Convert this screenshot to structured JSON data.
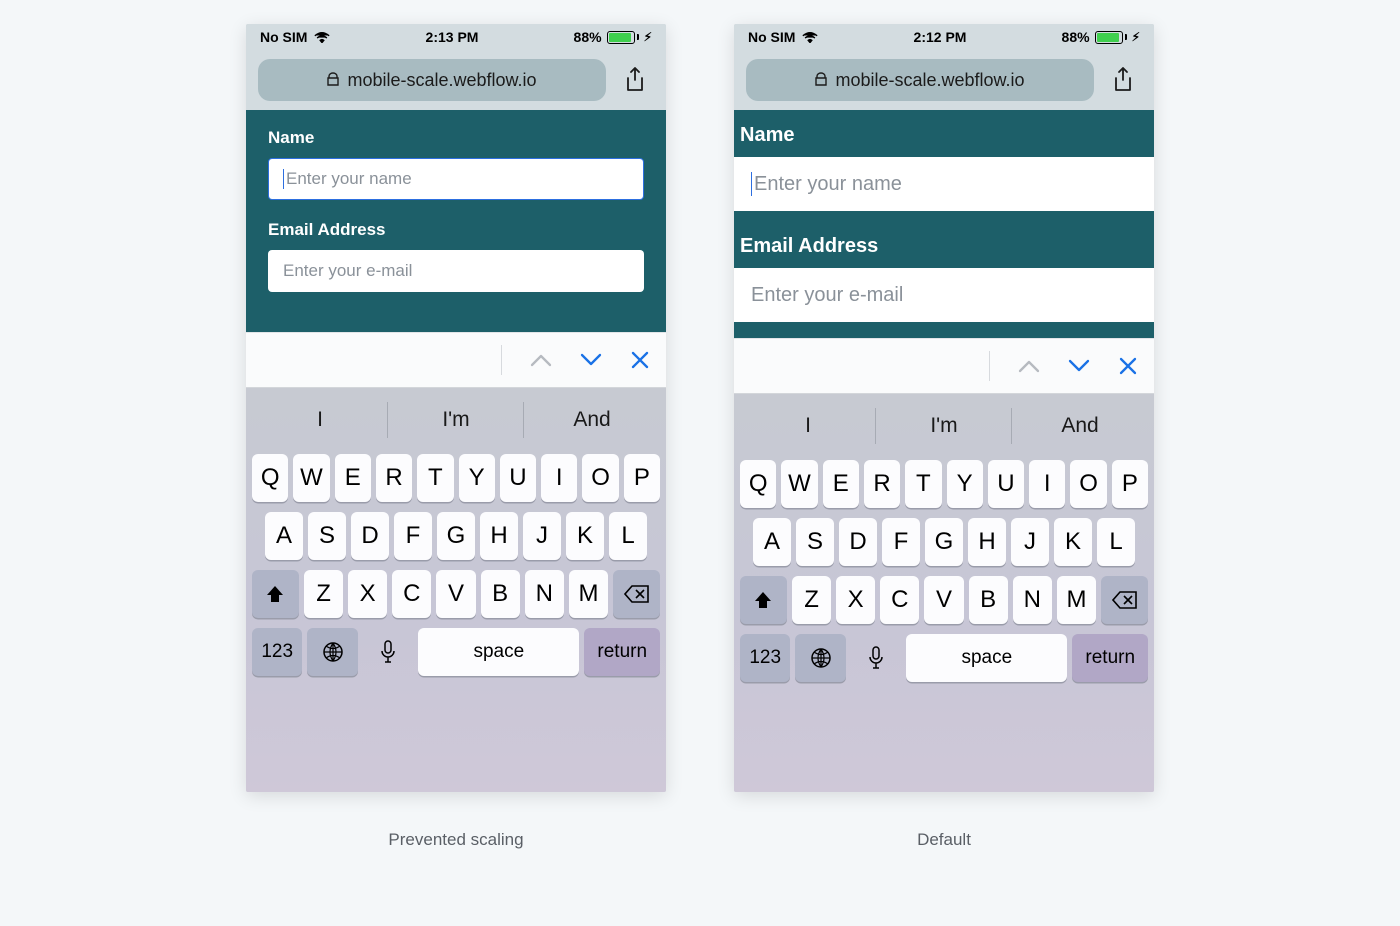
{
  "captions": {
    "left": "Prevented scaling",
    "right": "Default"
  },
  "statusbar": {
    "carrier": "No SIM",
    "time_left": "2:13 PM",
    "time_right": "2:12 PM",
    "battery_pct": "88%"
  },
  "browser": {
    "url": "mobile-scale.webflow.io"
  },
  "form": {
    "name_label": "Name",
    "name_placeholder": "Enter your name",
    "email_label": "Email Address",
    "email_placeholder": "Enter your e-mail"
  },
  "keyboard": {
    "suggestions": [
      "I",
      "I'm",
      "And"
    ],
    "row1": [
      "Q",
      "W",
      "E",
      "R",
      "T",
      "Y",
      "U",
      "I",
      "O",
      "P"
    ],
    "row2": [
      "A",
      "S",
      "D",
      "F",
      "G",
      "H",
      "J",
      "K",
      "L"
    ],
    "row3": [
      "Z",
      "X",
      "C",
      "V",
      "B",
      "N",
      "M"
    ],
    "numkey": "123",
    "space": "space",
    "return": "return"
  }
}
